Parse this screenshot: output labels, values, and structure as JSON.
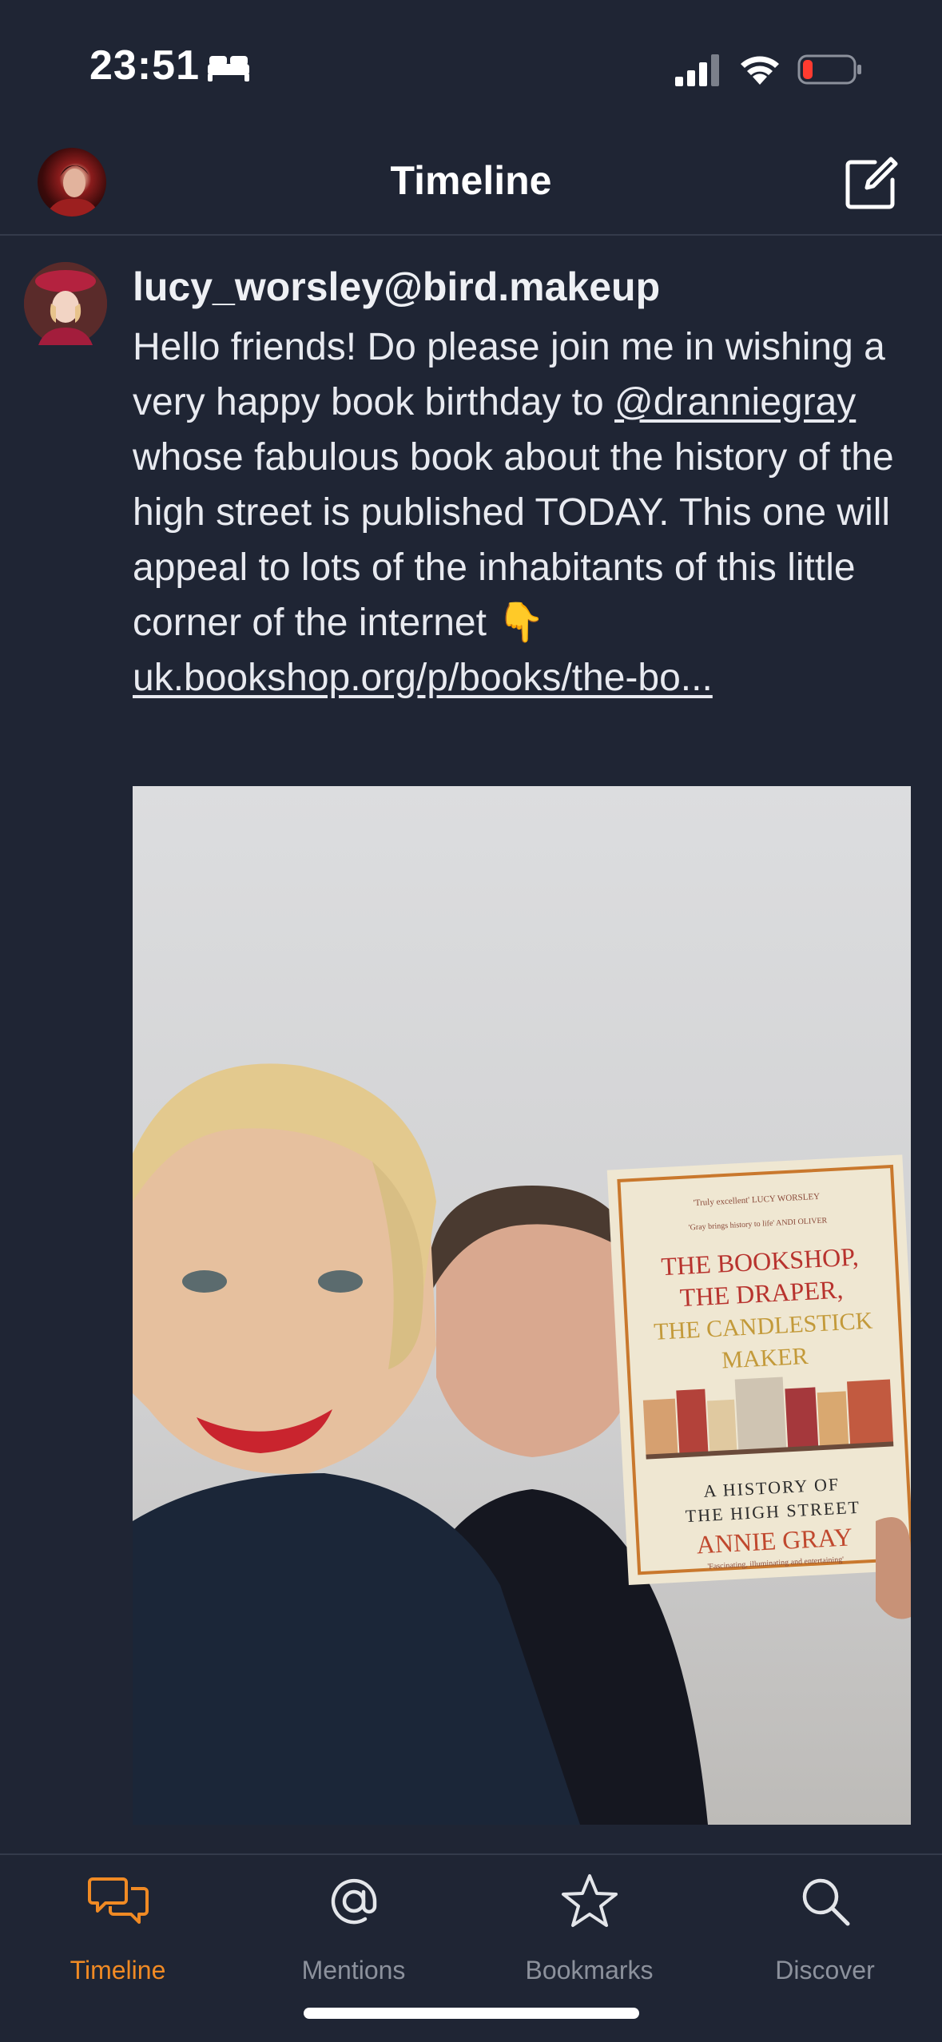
{
  "status": {
    "time": "23:51",
    "icons": [
      "bed-icon",
      "cellular-signal-icon",
      "wifi-icon",
      "battery-low-icon"
    ]
  },
  "nav": {
    "title": "Timeline",
    "icons": [
      "user-avatar",
      "compose-icon"
    ]
  },
  "post": {
    "author": "lucy_worsley@bird.makeup",
    "text_before_mention": "Hello friends! Do please join me in wishing a very happy book birthday to ",
    "mention": "@dranniegray",
    "text_after_mention": " whose fabulous book about the history of the high street is published TODAY. This one will appeal to lots of the inhabitants of this little corner of the internet 👇",
    "link": "uk.bookshop.org/p/books/the-bo...",
    "image": {
      "book_quote_1": "'Truly excellent' LUCY WORSLEY",
      "book_quote_2": "'Gray brings history to life' ANDI OLIVER",
      "book_title_lines": [
        "THE BOOKSHOP,",
        "THE DRAPER,",
        "THE CANDLESTICK",
        "MAKER"
      ],
      "book_subtitle_lines": [
        "A HISTORY OF",
        "THE HIGH STREET"
      ],
      "book_author": "ANNIE GRAY",
      "book_footer": "'Fascinating, illuminating and entertaining'"
    }
  },
  "tabs": [
    {
      "label": "Timeline",
      "icon": "chat-bubbles-icon",
      "active": true
    },
    {
      "label": "Mentions",
      "icon": "at-sign-icon",
      "active": false
    },
    {
      "label": "Bookmarks",
      "icon": "star-icon",
      "active": false
    },
    {
      "label": "Discover",
      "icon": "search-icon",
      "active": false
    }
  ],
  "colors": {
    "background": "#1f2534",
    "accent": "#f08a24",
    "inactive": "#8c919c",
    "text": "#eef0f4"
  }
}
